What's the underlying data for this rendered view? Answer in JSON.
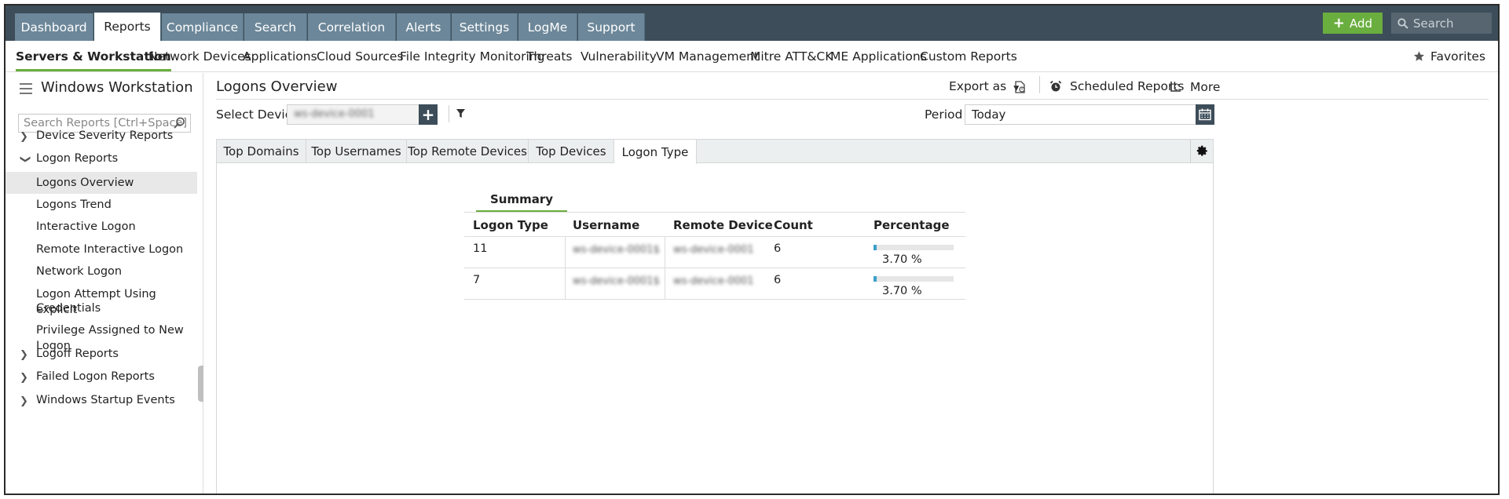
{
  "topnav": {
    "tabs": [
      "Dashboard",
      "Reports",
      "Compliance",
      "Search",
      "Correlation",
      "Alerts",
      "Settings",
      "LogMe",
      "Support"
    ],
    "active": "Reports",
    "add_label": "Add",
    "search_placeholder": "Search"
  },
  "subnav": {
    "items": [
      "Servers & Workstation",
      "Network Devices",
      "Applications",
      "Cloud Sources",
      "File Integrity Monitoring",
      "Threats",
      "Vulnerability",
      "VM Management",
      "Mitre ATT&CK",
      "ME Applications",
      "Custom Reports"
    ],
    "active": "Servers & Workstation",
    "favorites_label": "Favorites"
  },
  "sidebar": {
    "title": "Windows Workstation",
    "search_placeholder": "Search Reports [Ctrl+Space]",
    "items": [
      {
        "label": "Device Severity Reports",
        "type": "group",
        "expanded": false
      },
      {
        "label": "Logon Reports",
        "type": "group",
        "expanded": true
      },
      {
        "label": "Logons Overview",
        "type": "child",
        "selected": true
      },
      {
        "label": "Logons Trend",
        "type": "child"
      },
      {
        "label": "Interactive Logon",
        "type": "child"
      },
      {
        "label": "Remote Interactive Logon",
        "type": "child"
      },
      {
        "label": "Network Logon",
        "type": "child"
      },
      {
        "label": "Logon Attempt Using explicit",
        "label2": "Credentials",
        "type": "child"
      },
      {
        "label": "Privilege Assigned to New Logon",
        "type": "child"
      },
      {
        "label": "Logoff Reports",
        "type": "group",
        "expanded": false
      },
      {
        "label": "Failed Logon Reports",
        "type": "group",
        "expanded": false
      },
      {
        "label": "Windows Startup Events",
        "type": "group",
        "expanded": false
      }
    ]
  },
  "main": {
    "title": "Logons Overview",
    "export_label": "Export as",
    "scheduled_label": "Scheduled Reports",
    "more_label": "More",
    "select_device_label": "Select Device",
    "device_value": "ws-device-0001",
    "period_label": "Period",
    "period_value": "Today",
    "tabs": [
      "Top Domains",
      "Top Usernames",
      "Top Remote Devices",
      "Top Devices",
      "Logon Type"
    ],
    "active_tab": "Logon Type",
    "summary_label": "Summary",
    "table": {
      "headers": [
        "Logon Type",
        "Username",
        "Remote Device",
        "Count",
        "Percentage"
      ],
      "rows": [
        {
          "logon_type": "11",
          "username": "ws-device-0001$",
          "remote_device": "ws-device-0001",
          "count": "6",
          "percentage": "3.70 %",
          "pct_value": 3.7
        },
        {
          "logon_type": "7",
          "username": "ws-device-0001$",
          "remote_device": "ws-device-0001",
          "count": "6",
          "percentage": "3.70 %",
          "pct_value": 3.7
        }
      ]
    }
  },
  "colors": {
    "topbar": "#3d4d59",
    "tab": "#6c8799",
    "accent_green": "#6aae3f",
    "bar_fill": "#3c9fc9"
  }
}
